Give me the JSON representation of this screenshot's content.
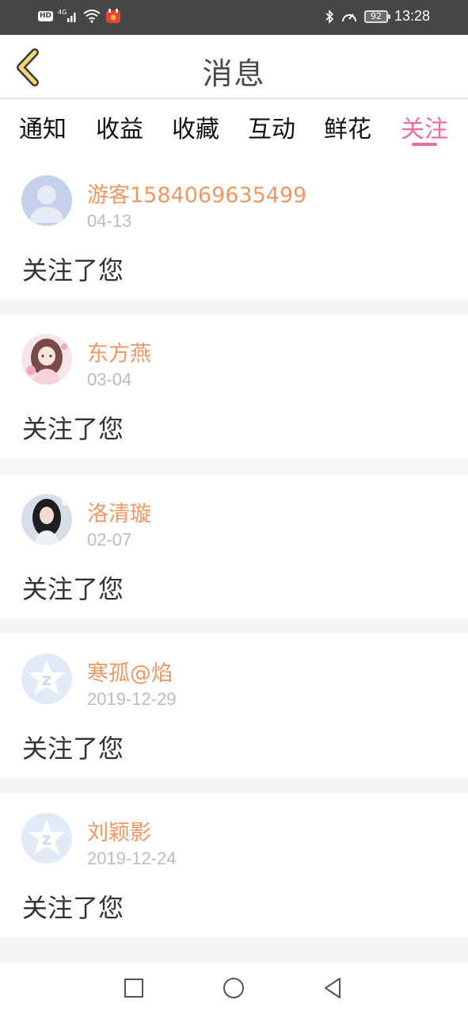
{
  "status_bar": {
    "hd": "HD",
    "network": "4G",
    "battery": "92",
    "time": "13:28"
  },
  "header": {
    "title": "消息"
  },
  "tabs": [
    {
      "label": "通知",
      "active": false
    },
    {
      "label": "收益",
      "active": false
    },
    {
      "label": "收藏",
      "active": false
    },
    {
      "label": "互动",
      "active": false
    },
    {
      "label": "鲜花",
      "active": false
    },
    {
      "label": "关注",
      "active": true
    }
  ],
  "messages": [
    {
      "name": "游客1584069635499",
      "date": "04-13",
      "text": "关注了您",
      "avatar": "default-user-avatar"
    },
    {
      "name": "东方燕",
      "date": "03-04",
      "text": "关注了您",
      "avatar": "anime-girl-avatar"
    },
    {
      "name": "洛清璇",
      "date": "02-07",
      "text": "关注了您",
      "avatar": "photo-girl-avatar"
    },
    {
      "name": "寒孤@焰",
      "date": "2019-12-29",
      "text": "关注了您",
      "avatar": "qq-zone-avatar"
    },
    {
      "name": "刘颖影",
      "date": "2019-12-24",
      "text": "关注了您",
      "avatar": "qq-zone-avatar"
    }
  ],
  "colors": {
    "accent": "#ea6ba5",
    "username": "#ef9866",
    "back_arrow": "#f2d77a"
  }
}
